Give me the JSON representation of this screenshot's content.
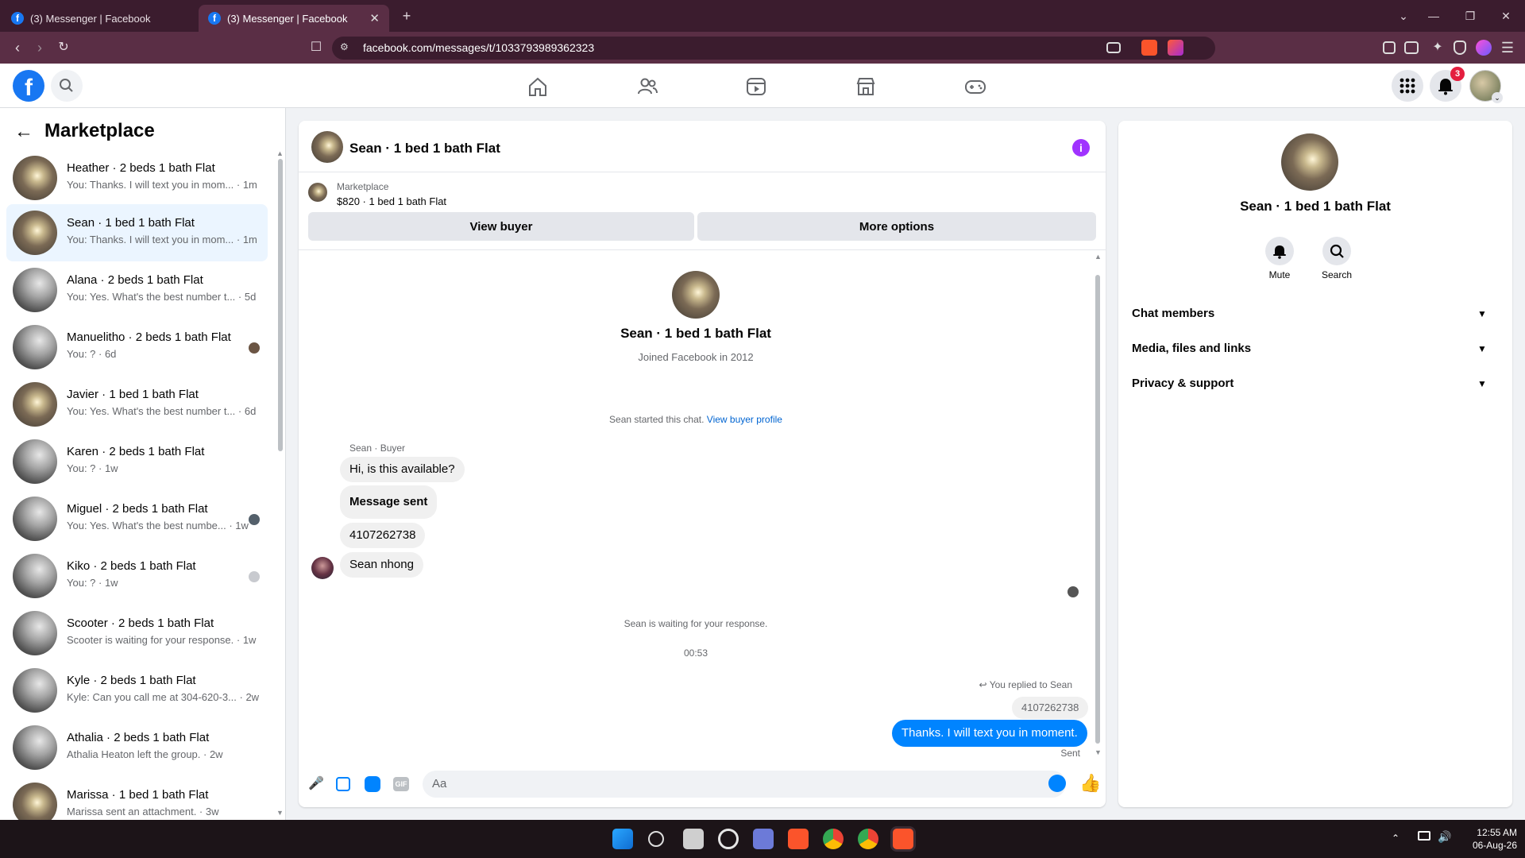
{
  "browser": {
    "tabs": [
      {
        "label": "(3) Messenger | Facebook"
      },
      {
        "label": "(3) Messenger | Facebook"
      }
    ],
    "url": "facebook.com/messages/t/1033793989362323"
  },
  "header": {
    "notification_count": "3",
    "nav_icons": [
      "home-icon",
      "friends-icon",
      "watch-icon",
      "marketplace-icon",
      "gaming-icon"
    ]
  },
  "sidebar": {
    "title": "Marketplace",
    "conversations": [
      {
        "name": "Heather · 2 beds 1 bath Flat",
        "preview": "You: Thanks. I will text you in mom... · 1m"
      },
      {
        "name": "Sean · 1 bed 1 bath Flat",
        "preview": "You: Thanks. I will text you in mom... · 1m"
      },
      {
        "name": "Alana · 2 beds 1 bath Flat",
        "preview": "You: Yes. What's the best number t... · 5d"
      },
      {
        "name": "Manuelitho · 2 beds 1 bath Flat",
        "preview": "You: ? · 6d"
      },
      {
        "name": "Javier · 1 bed 1 bath Flat",
        "preview": "You: Yes. What's the best number t... · 6d"
      },
      {
        "name": "Karen · 2 beds 1 bath Flat",
        "preview": "You: ? · 1w"
      },
      {
        "name": "Miguel · 2 beds 1 bath Flat",
        "preview": "You: Yes. What's the best numbe... · 1w"
      },
      {
        "name": "Kiko · 2 beds 1 bath Flat",
        "preview": "You: ? · 1w"
      },
      {
        "name": "Scooter · 2 beds 1 bath Flat",
        "preview": "Scooter is waiting for your response. · 1w"
      },
      {
        "name": "Kyle · 2 beds 1 bath Flat",
        "preview": "Kyle: Can you call me at 304-620-3... · 2w"
      },
      {
        "name": "Athalia · 2 beds 1 bath Flat",
        "preview": "Athalia Heaton left the group. · 2w"
      },
      {
        "name": "Marissa · 1 bed 1 bath Flat",
        "preview": "Marissa sent an attachment. · 3w"
      }
    ]
  },
  "chat": {
    "title": "Sean · 1 bed 1 bath Flat",
    "listing_source": "Marketplace",
    "listing_title": "$820 · 1 bed 1 bath Flat",
    "view_buyer": "View buyer",
    "more_options": "More options",
    "profile_name": "Sean · 1 bed 1 bath Flat",
    "joined": "Joined Facebook in 2012",
    "started": "Sean started this chat.",
    "view_profile_link": "View buyer profile",
    "sender_label": "Sean · Buyer",
    "incoming": [
      "Hi, is this available?",
      "Message sent",
      "4107262738",
      "Sean nhong"
    ],
    "waiting": "Sean is waiting for your response.",
    "time": "00:53",
    "replied_to": "You replied to Sean",
    "quoted": "4107262738",
    "outgoing": "Thanks. I will text you in moment.",
    "status": "Sent",
    "composer_placeholder": "Aa"
  },
  "info_panel": {
    "name": "Sean · 1 bed 1 bath Flat",
    "mute": "Mute",
    "search": "Search",
    "sections": [
      "Chat members",
      "Media, files and links",
      "Privacy & support"
    ]
  },
  "taskbar": {
    "time": "12:55 AM",
    "date": "06-Aug-26"
  },
  "colors": {
    "brand_blue": "#1877f2",
    "messenger_blue": "#0084ff",
    "browser_frame": "#3b1c2e",
    "info_purple": "#a033ff"
  }
}
